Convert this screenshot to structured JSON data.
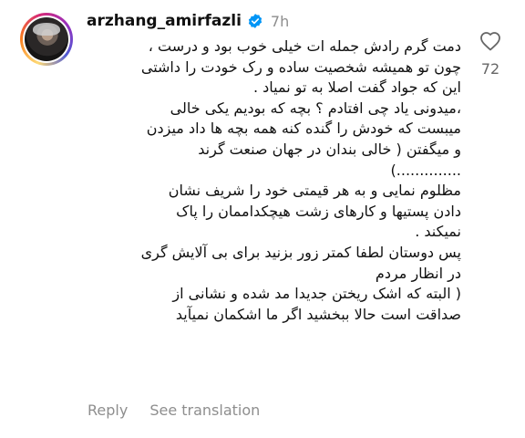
{
  "post_comment": {
    "username": "arzhang_amirfazli",
    "time": "7h",
    "lines": [
      "دمت گرم رادش جمله ات خیلی خوب بود و درست ،",
      "چون تو همیشه شخصیت ساده و رک خودت را داشتی",
      "این که جواد گفت اصلا به تو نمیاد .",
      "،میدونی یاد چی افتادم ؟ بچه که بودیم یکی خالی",
      "میبست که خودش را گنده کنه همه بچه ها داد میزدن",
      "و میگفتن ( خالی بندان در جهان صنعت گرند",
      "..............)",
      "مظلوم نمایی و به هر قیمتی خود را شریف نشان",
      "دادن پستیها و کارهای زشت هیچکداممان را پاک",
      "نمیکند .",
      "پس دوستان لطفا کمتر زور بزنید برای بی آلایش گری",
      "در  انظار مردم",
      "( البته که اشک ریختن جدیدا مد شده و نشانی از",
      "صداقت است حالا ببخشید اگر ما اشکمان نمیآید"
    ],
    "like_count": "72",
    "reply_label": "Reply",
    "translate_label": "See translation"
  },
  "icons": {
    "verified": "verified-badge-icon",
    "like": "heart-outline-icon"
  },
  "colors": {
    "verified": "#0095f6",
    "muted": "#8e8e8e"
  }
}
